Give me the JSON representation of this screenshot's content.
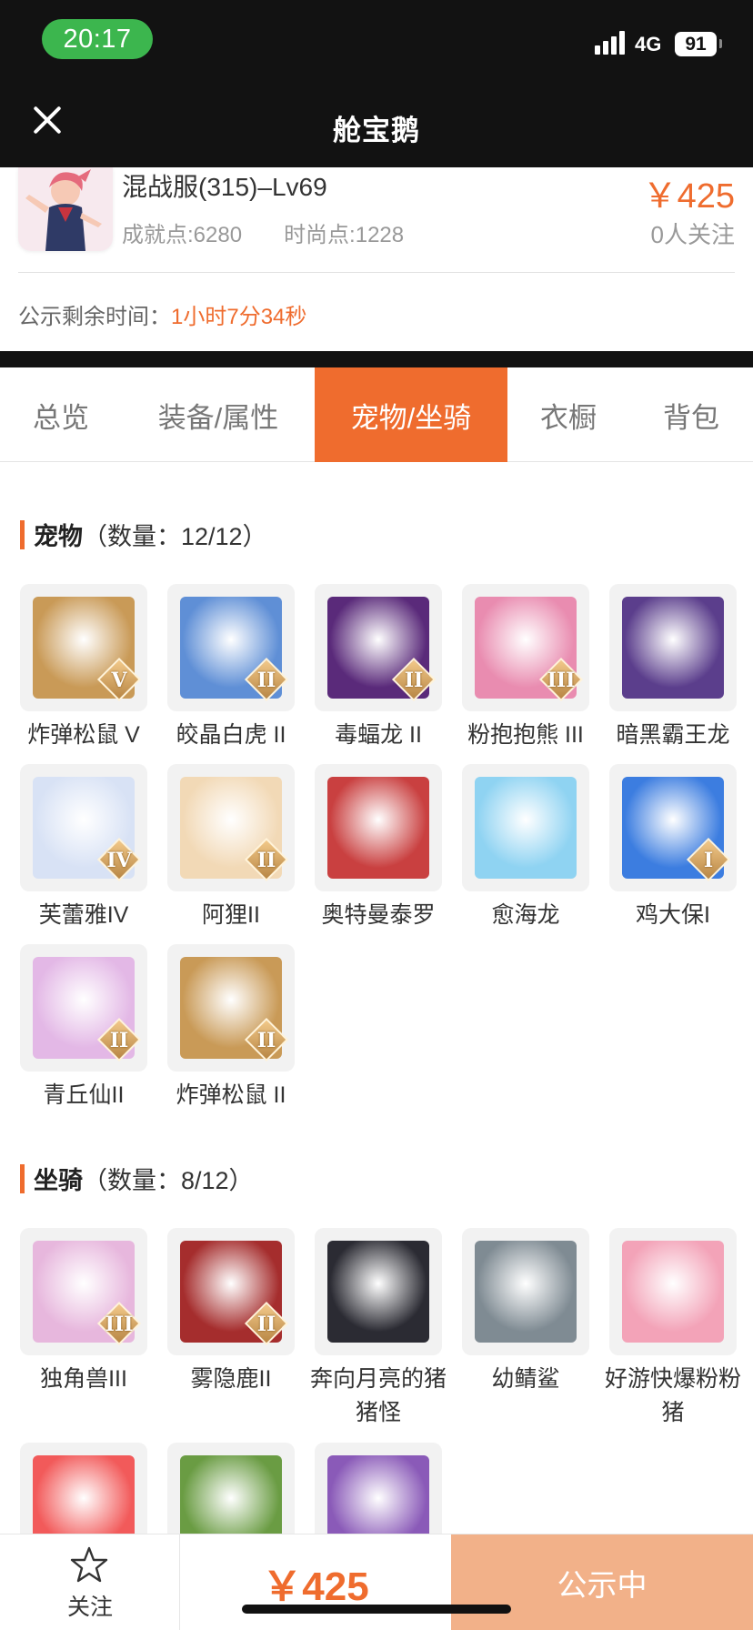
{
  "status_bar": {
    "time": "20:17",
    "network": "4G",
    "battery": "91"
  },
  "nav": {
    "title": "舱宝鹅"
  },
  "product": {
    "server_level": "混战服(315)–Lv69",
    "achievement": "成就点:6280",
    "fashion": "时尚点:1228",
    "price": "￥425",
    "followers": "0人关注",
    "remain_label": "公示剩余时间：",
    "remain_value": "1小时7分34秒"
  },
  "tabs": [
    {
      "label": "总览"
    },
    {
      "label": "装备/属性"
    },
    {
      "label": "宠物/坐骑",
      "active": true
    },
    {
      "label": "衣橱"
    },
    {
      "label": "背包"
    }
  ],
  "pets": {
    "title": "宠物",
    "count": "（数量：12/12）",
    "items": [
      {
        "name": "炸弹松鼠 V",
        "badge": "V",
        "icon": "squirrel-icon",
        "color": "#c99a57"
      },
      {
        "name": "皎晶白虎 II",
        "badge": "II",
        "icon": "white-tiger-icon",
        "color": "#5f8fd6"
      },
      {
        "name": "毒蝠龙 II",
        "badge": "II",
        "icon": "bat-dragon-icon",
        "color": "#5a2a7a"
      },
      {
        "name": "粉抱抱熊 III",
        "badge": "III",
        "icon": "pink-bear-icon",
        "color": "#e98cb0"
      },
      {
        "name": "暗黑霸王龙",
        "badge": "",
        "icon": "dark-trex-icon",
        "color": "#5b3e8c"
      },
      {
        "name": "芙蕾雅IV",
        "badge": "IV",
        "icon": "freya-icon",
        "color": "#d8e2f5"
      },
      {
        "name": "阿狸II",
        "badge": "II",
        "icon": "ali-fox-icon",
        "color": "#f2d9b6"
      },
      {
        "name": "奥特曼泰罗",
        "badge": "",
        "icon": "ultraman-icon",
        "color": "#c94040"
      },
      {
        "name": "愈海龙",
        "badge": "",
        "icon": "sea-dragon-icon",
        "color": "#8fd3f2"
      },
      {
        "name": "鸡大保I",
        "badge": "I",
        "icon": "chicken-icon",
        "color": "#3c7de0"
      },
      {
        "name": "青丘仙II",
        "badge": "II",
        "icon": "fox-fairy-icon",
        "color": "#e3b8e6"
      },
      {
        "name": "炸弹松鼠 II",
        "badge": "II",
        "icon": "squirrel-icon",
        "color": "#c99a57"
      }
    ]
  },
  "mounts": {
    "title": "坐骑",
    "count": "（数量：8/12）",
    "items": [
      {
        "name": "独角兽III",
        "badge": "III",
        "icon": "unicorn-icon",
        "color": "#e7b7dd"
      },
      {
        "name": "雾隐鹿II",
        "badge": "II",
        "icon": "mist-deer-icon",
        "color": "#a52d2d"
      },
      {
        "name": "奔向月亮的猪猪怪",
        "badge": "",
        "icon": "moon-pig-icon",
        "color": "#2b2b33"
      },
      {
        "name": "幼鲭鲨",
        "badge": "",
        "icon": "shark-icon",
        "color": "#7f8b93"
      },
      {
        "name": "好游快爆粉粉猪",
        "badge": "",
        "icon": "pink-pig-icon",
        "color": "#f3a3b8"
      },
      {
        "name": "",
        "badge": "",
        "icon": "red-fox-icon",
        "color": "#f25a5a"
      },
      {
        "name": "",
        "badge": "",
        "icon": "green-dragon-icon",
        "color": "#6a9c43"
      },
      {
        "name": "",
        "badge": "",
        "icon": "violet-dragon-icon",
        "color": "#8a5ab8"
      }
    ]
  },
  "bottom": {
    "follow_label": "关注",
    "price": "￥425",
    "action": "公示中"
  },
  "colors": {
    "accent": "#ef6c2e",
    "dark": "#121212",
    "status_green": "#3cb64e",
    "action_bg": "#f2b189"
  }
}
